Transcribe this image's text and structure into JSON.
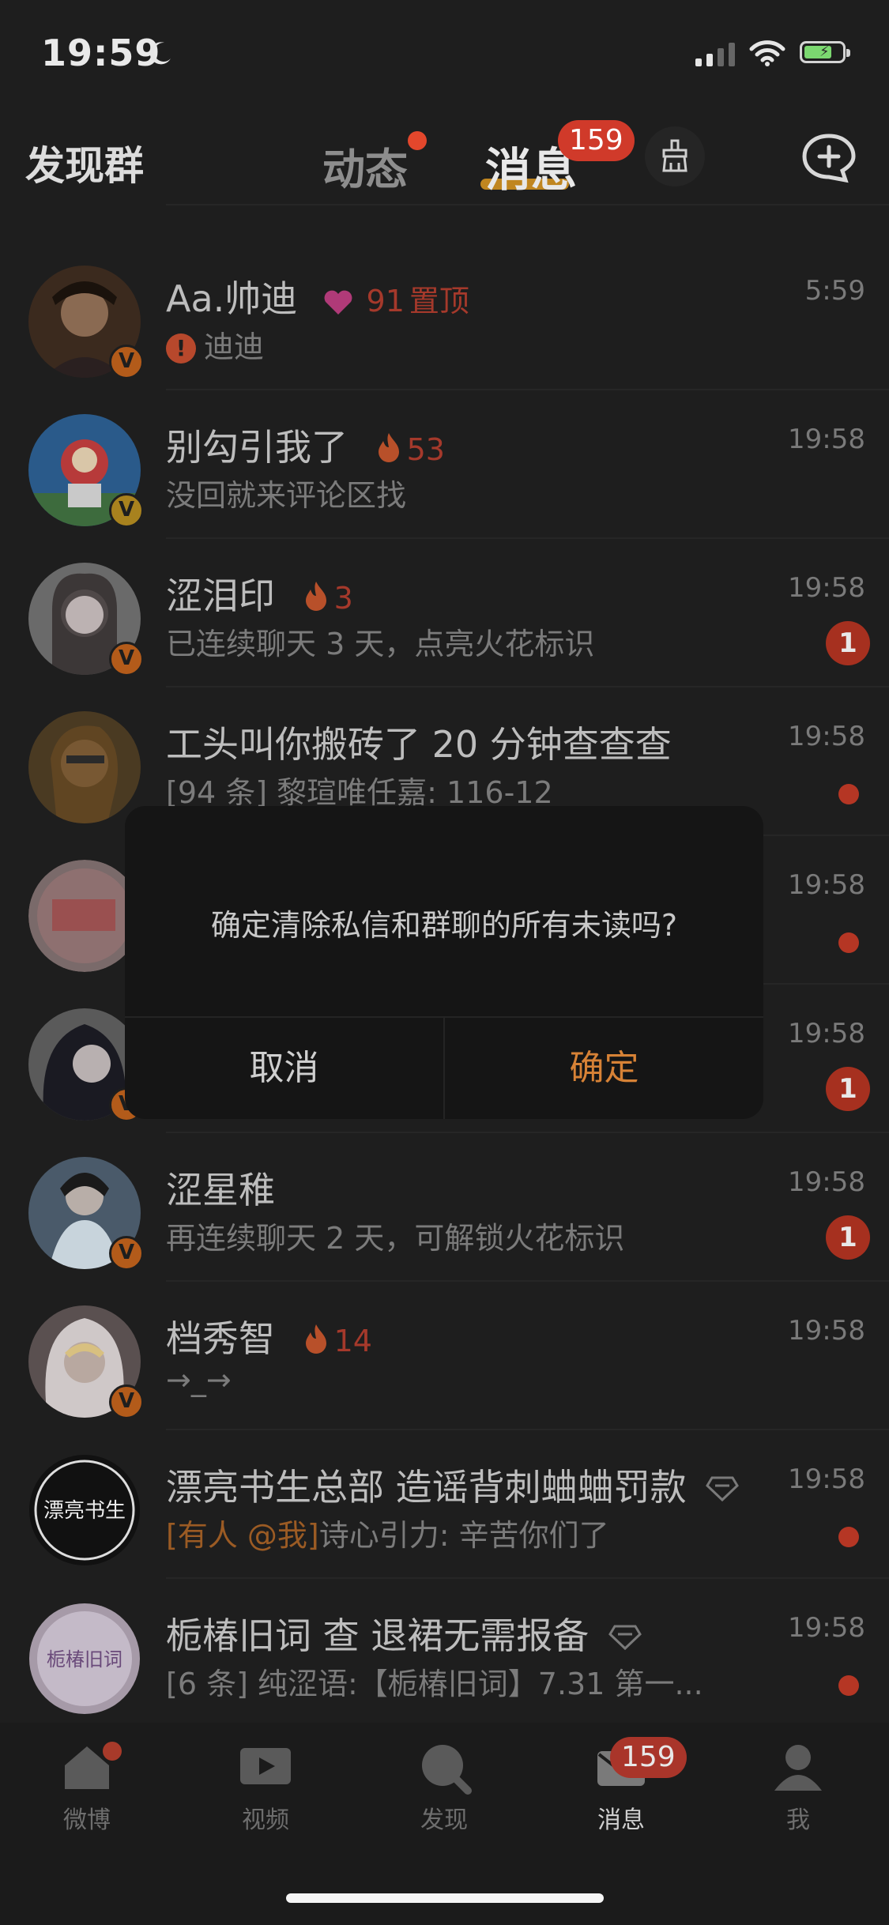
{
  "status_bar": {
    "time": "19:59"
  },
  "top_nav": {
    "left_label": "发现群",
    "tab_dongtai": "动态",
    "tab_xiaoxi": "消息",
    "badge": "159"
  },
  "conversations": [
    {
      "name": "Aa.帅迪",
      "heart_count": "91",
      "pin": "置顶",
      "sub": "迪迪",
      "time": "5:59"
    },
    {
      "name": "别勾引我了",
      "fire": "53",
      "sub": "没回就来评论区找",
      "time": "19:58"
    },
    {
      "name": "涩泪印",
      "fire": "3",
      "sub": "已连续聊天 3 天，点亮火花标识",
      "time": "19:58",
      "unread": "1"
    },
    {
      "name": "工头叫你搬砖了 20 分钟查查查",
      "sub": "[94 条] 黎瑄唯任嘉: 116-12",
      "time": "19:58"
    },
    {
      "time": "19:58"
    },
    {
      "time": "19:58",
      "unread": "1"
    },
    {
      "name": "涩星稚",
      "sub": "再连续聊天 2 天，可解锁火花标识",
      "time": "19:58",
      "unread": "1"
    },
    {
      "name": "档秀智",
      "fire": "14",
      "sub": "→_→",
      "time": "19:58"
    },
    {
      "name": "漂亮书生总部 造谣背刺蛐蛐罚款",
      "sub_prefix": "[有人 @我]",
      "sub": "诗心引力: 辛苦你们了",
      "time": "19:58"
    },
    {
      "name": "栀椿旧词 查 退裙无需报备",
      "sub": "[6 条] 纯涩语:【栀椿旧词】7.31 第一...",
      "time": "19:58"
    }
  ],
  "dialog": {
    "message": "确定清除私信和群聊的所有未读吗?",
    "cancel": "取消",
    "confirm": "确定"
  },
  "bottom_tabs": [
    {
      "label": "微博"
    },
    {
      "label": "视频"
    },
    {
      "label": "发现"
    },
    {
      "label": "消息",
      "badge": "159"
    },
    {
      "label": "我"
    }
  ],
  "avatar_texts": {
    "shusheng": "漂亮书生",
    "zhichun": "栀椿旧词"
  },
  "colors": {
    "accent": "#e8a020",
    "badge_red": "#d03a2a",
    "confirm_orange": "#d78236"
  }
}
